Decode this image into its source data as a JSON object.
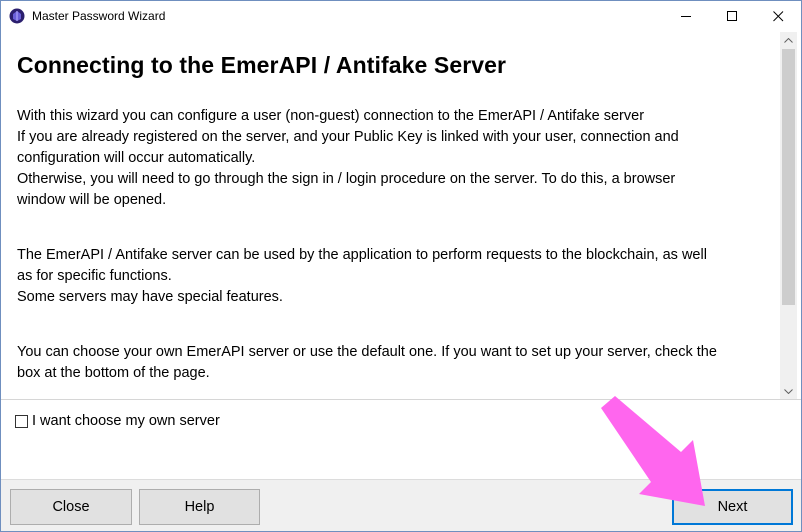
{
  "window": {
    "title": "Master Password Wizard",
    "icon": "emer-app-icon"
  },
  "titlebar_buttons": {
    "minimize_icon": "minimize-icon",
    "maximize_icon": "maximize-icon",
    "close_icon": "close-icon"
  },
  "content": {
    "heading": "Connecting to the EmerAPI / Antifake Server",
    "paragraph1": [
      "With this wizard you can configure a user (non-guest) connection to the EmerAPI / Antifake server",
      "If you are already registered on the server, and your Public Key is linked with your user, connection and",
      "configuration will occur automatically.",
      "Otherwise, you will need to go through the sign in / login procedure on the server. To do this, a browser",
      "window will be opened."
    ],
    "paragraph2": [
      "The EmerAPI / Antifake server can be used by the application to perform requests to the blockchain, as well",
      "as for specific functions.",
      "Some servers may have special features."
    ],
    "paragraph3": [
      "You can choose your own EmerAPI server or use the default one. If you want to set up your server, check the",
      "box at the bottom of the page."
    ]
  },
  "checkbox": {
    "label": "I want choose my own server",
    "checked": false
  },
  "buttons": {
    "close": "Close",
    "help": "Help",
    "next": "Next"
  },
  "colors": {
    "accent": "#0078d7",
    "annotation_arrow": "#ff66ee",
    "button_face": "#e1e1e1",
    "bottom_bar": "#f0f0f0"
  }
}
